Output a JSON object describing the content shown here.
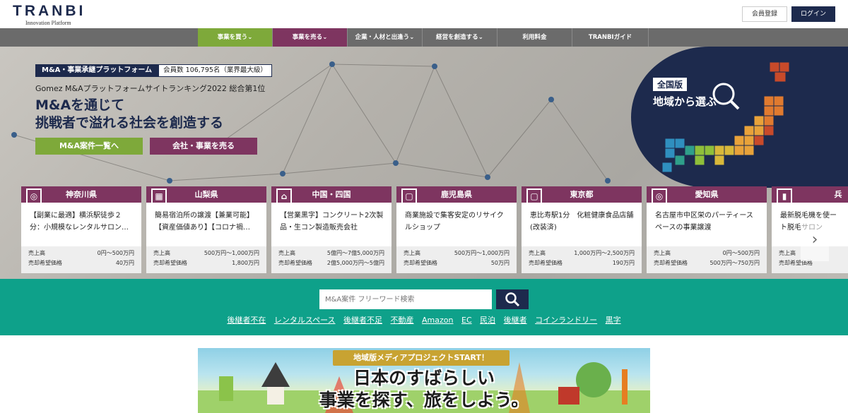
{
  "header": {
    "logo_main": "TRANBI",
    "logo_sub": "Innovation Platform",
    "register_label": "会員登録",
    "login_label": "ログイン"
  },
  "nav": {
    "items": [
      {
        "label": "事業を買う",
        "color": "#7ea93a"
      },
      {
        "label": "事業を売る",
        "color": "#7e3560"
      },
      {
        "label": "企業・人材と出逢う",
        "color": "#6b6b6b"
      },
      {
        "label": "経営を創造する",
        "color": "#6b6b6b"
      },
      {
        "label": "利用料金",
        "color": "#6b6b6b"
      },
      {
        "label": "TRANBIガイド",
        "color": "#6b6b6b"
      }
    ]
  },
  "hero": {
    "tag": "M&A・事業承継プラットフォーム",
    "members": "会員数 106,795名（業界最大級）",
    "rank": "Gomez M&Aプラットフォームサイトランキング2022 総合第1位",
    "title_line1": "M&Aを通じて",
    "title_line2": "挑戦者で溢れる社会を創造する",
    "btn_list": "M&A案件一覧へ",
    "btn_sell": "会社・事業を売る",
    "region_badge": "全国版",
    "region_text": "地域から選ぶ"
  },
  "cards": [
    {
      "region": "神奈川県",
      "icon": "globe-icon",
      "title": "【副業に最適】横浜駅徒歩２分：小規模なレンタルサロン…",
      "sales_label": "売上高",
      "sales": "0円〜500万円",
      "price_label": "売却希望価格",
      "price": "40万円"
    },
    {
      "region": "山梨県",
      "icon": "register-icon",
      "title": "簡易宿泊所の譲渡【兼業可能】【資産価値あり】【コロナ禍…",
      "sales_label": "売上高",
      "sales": "500万円〜1,000万円",
      "price_label": "売却希望価格",
      "price": "1,800万円"
    },
    {
      "region": "中国・四国",
      "icon": "factory-icon",
      "title": "【営業黒字】コンクリート2次製品・生コン製造販売会社",
      "sales_label": "売上高",
      "sales": "5億円〜7億5,000万円",
      "price_label": "売却希望価格",
      "price": "2億5,000万円〜5億円"
    },
    {
      "region": "鹿児島県",
      "icon": "bag-icon",
      "title": "商業施設で集客安定のリサイクルショップ",
      "sales_label": "売上高",
      "sales": "500万円〜1,000万円",
      "price_label": "売却希望価格",
      "price": "50万円"
    },
    {
      "region": "東京都",
      "icon": "bag-icon",
      "title": "恵比寿駅1分　化粧健康食品店舗(改装済)",
      "sales_label": "売上高",
      "sales": "1,000万円〜2,500万円",
      "price_label": "売却希望価格",
      "price": "190万円"
    },
    {
      "region": "愛知県",
      "icon": "globe-icon",
      "title": "名古屋市中区栄のパーティースペースの事業譲渡",
      "sales_label": "売上高",
      "sales": "0円〜500万円",
      "price_label": "売却希望価格",
      "price": "500万円〜750万円"
    },
    {
      "region": "兵",
      "icon": "lipstick-icon",
      "title": "最新脱毛機を使ート脱毛サロン",
      "sales_label": "売上高",
      "sales": "",
      "price_label": "売却希望価格",
      "price": ""
    }
  ],
  "search": {
    "placeholder": "M&A案件 フリーワード検索",
    "keywords": [
      "後継者不在",
      "レンタルスペース",
      "後継者不足",
      "不動産",
      "Amazon",
      "EC",
      "民泊",
      "後継者",
      "コインランドリー",
      "黒字"
    ]
  },
  "banner": {
    "top": "地域版メディアプロジェクトSTART！",
    "line1": "日本のすばらしい",
    "line2": "事業を探す、旅をしよう。"
  }
}
